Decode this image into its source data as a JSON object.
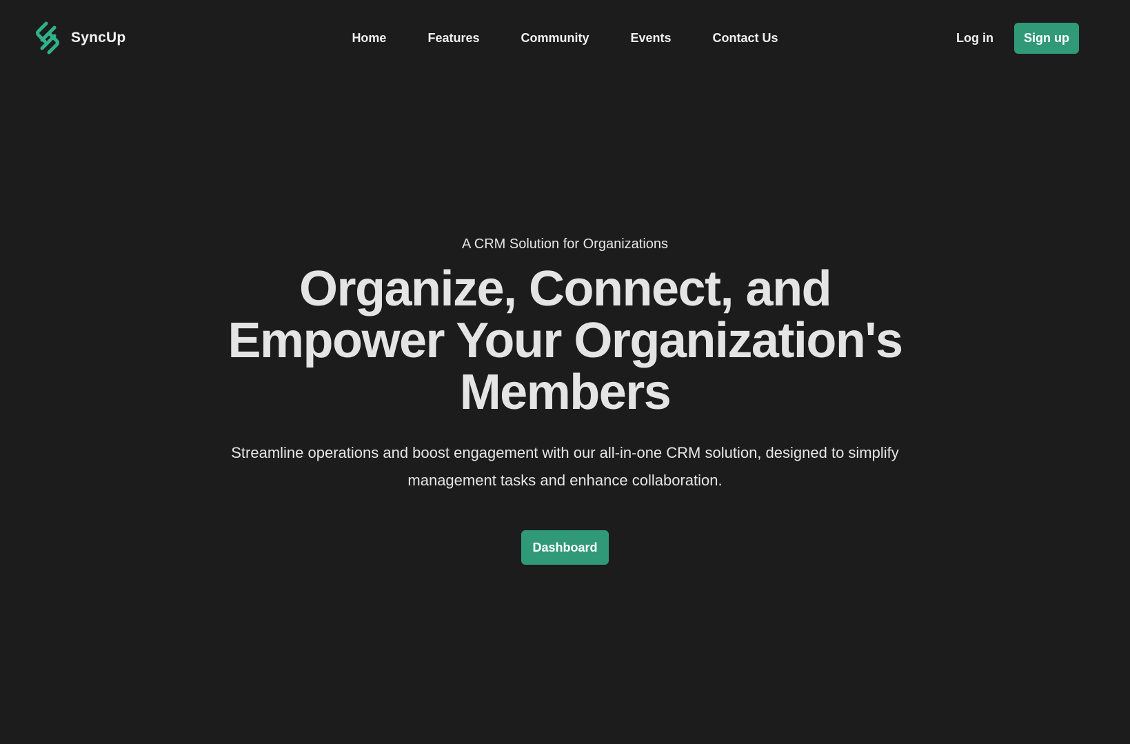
{
  "header": {
    "brand_name": "SyncUp",
    "logo_icon": "link-chain-icon",
    "nav": [
      {
        "label": "Home"
      },
      {
        "label": "Features"
      },
      {
        "label": "Community"
      },
      {
        "label": "Events"
      },
      {
        "label": "Contact Us"
      }
    ],
    "login_label": "Log in",
    "signup_label": "Sign up"
  },
  "hero": {
    "eyebrow": "A CRM Solution for Organizations",
    "headline": "Organize, Connect, and Empower Your Organization's Members",
    "subtext": "Streamline operations and boost engagement with our all-in-one CRM solution, designed to simplify management tasks and enhance collaboration.",
    "cta_label": "Dashboard"
  },
  "colors": {
    "background": "#1c1c1c",
    "accent": "#2f9978",
    "logo": "#2fb28a",
    "text": "#e8e8e8"
  }
}
